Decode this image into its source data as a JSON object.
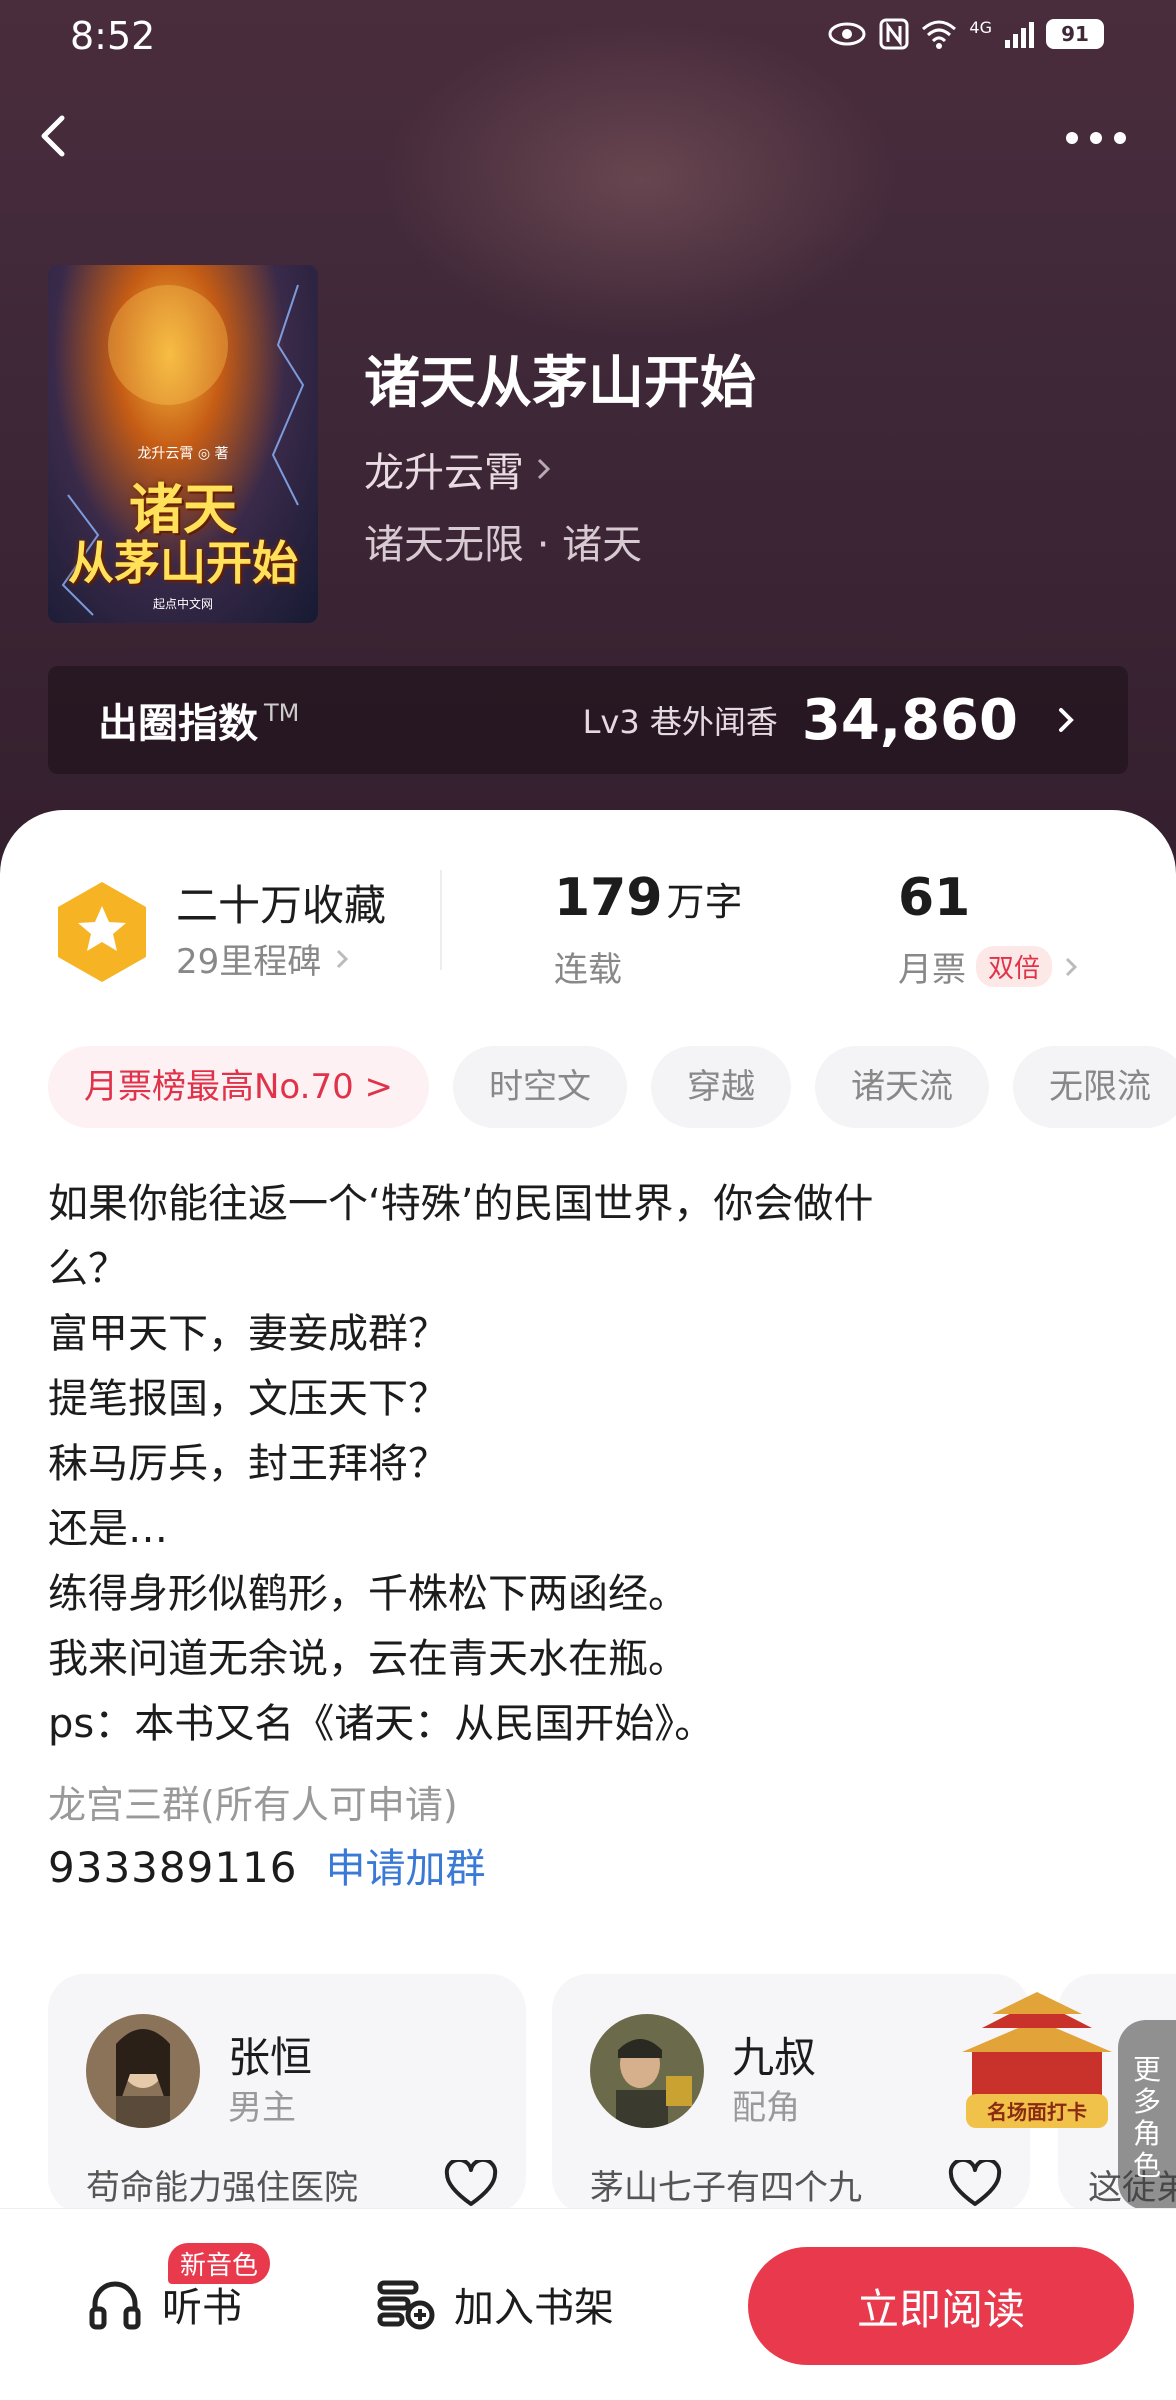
{
  "status_bar": {
    "time": "8:52",
    "network": "4G",
    "battery": "91"
  },
  "header": {
    "back_icon": "chevron-left-icon",
    "more_icon": "more-dots-icon"
  },
  "book": {
    "cover": {
      "author_text": "龙升云霄 ◎ 著",
      "title_line1": "诸天",
      "title_line2": "从茅山开始",
      "publisher": "起点中文网"
    },
    "title": "诸天从茅山开始",
    "author": "龙升云霄",
    "genre": "诸天无限 · 诸天"
  },
  "index": {
    "label": "出圈指数",
    "tm": "TM",
    "level": "Lv3 巷外闻香",
    "value": "34,860"
  },
  "stats": {
    "collect_title": "二十万收藏",
    "collect_sub": "29里程碑",
    "words_num": "179",
    "words_unit": "万字",
    "words_label": "连载",
    "tickets_num": "61",
    "tickets_label": "月票",
    "tickets_badge": "双倍"
  },
  "tags": [
    "月票榜最高No.70 >",
    "时空文",
    "穿越",
    "诸天流",
    "无限流"
  ],
  "synopsis": [
    "如果你能往返一个‘特殊’的民国世界，你会做什",
    "么？",
    "富甲天下，妻妾成群？",
    "提笔报国，文压天下？",
    "秣马厉兵，封王拜将？",
    "还是…",
    "练得身形似鹤形，千株松下两函经。",
    "我来问道无余说，云在青天水在瓶。",
    "ps：本书又名《诸天：从民国开始》。"
  ],
  "group": {
    "label": "龙宫三群(所有人可申请)",
    "number": "933389116",
    "apply": "申请加群"
  },
  "characters": [
    {
      "name": "张恒",
      "role": "男主",
      "desc": "苟命能力强住医院"
    },
    {
      "name": "九叔",
      "role": "配角",
      "desc": "茅山七子有四个九"
    },
    {
      "desc": "这徒弟"
    }
  ],
  "checkin": {
    "label": "名场面打卡"
  },
  "more_roles": {
    "label": "更多角色"
  },
  "bottom": {
    "listen": "听书",
    "new_voice": "新音色",
    "add_shelf": "加入书架",
    "read_now": "立即阅读"
  },
  "colors": {
    "accent": "#e8394d",
    "link": "#3a7ad6",
    "hero_bg": "#3f2838",
    "badge_gold": "#f6b425"
  }
}
